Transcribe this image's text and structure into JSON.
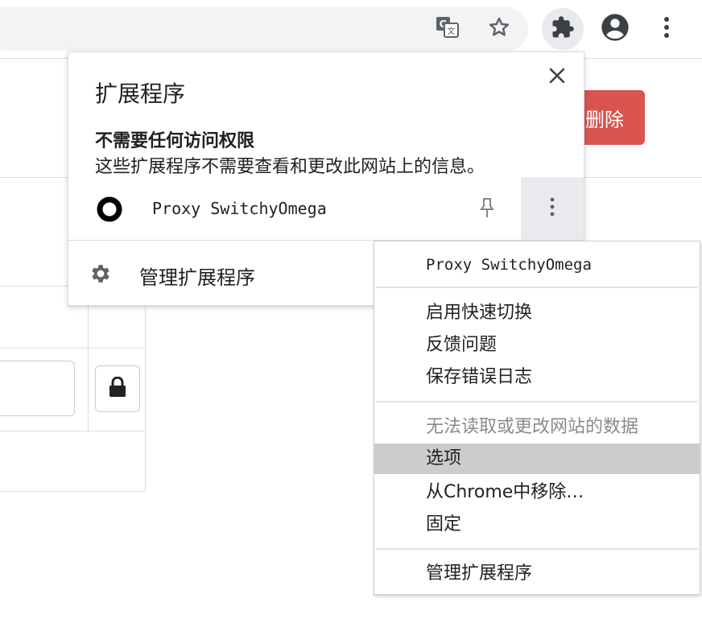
{
  "toolbar": {
    "icons": [
      "translate-icon",
      "star-icon",
      "puzzle-icon",
      "account-icon",
      "more-vert-icon"
    ]
  },
  "page": {
    "delete_button": "删除"
  },
  "extensions_popup": {
    "title": "扩展程序",
    "section_title": "不需要任何访问权限",
    "section_desc": "这些扩展程序不需要查看和更改此网站上的信息。",
    "extension": {
      "name": "Proxy SwitchyOmega"
    },
    "manage_label": "管理扩展程序"
  },
  "context_menu": {
    "header": "Proxy SwitchyOmega",
    "items": [
      "启用快速切换",
      "反馈问题",
      "保存错误日志"
    ],
    "disabled_item": "无法读取或更改网站的数据",
    "options": "选项",
    "remove": "从Chrome中移除…",
    "pin": "固定",
    "manage": "管理扩展程序"
  },
  "colors": {
    "delete_button": "#d9534f",
    "highlight": "#cccccc",
    "toolbar_active": "#e8eaed"
  }
}
